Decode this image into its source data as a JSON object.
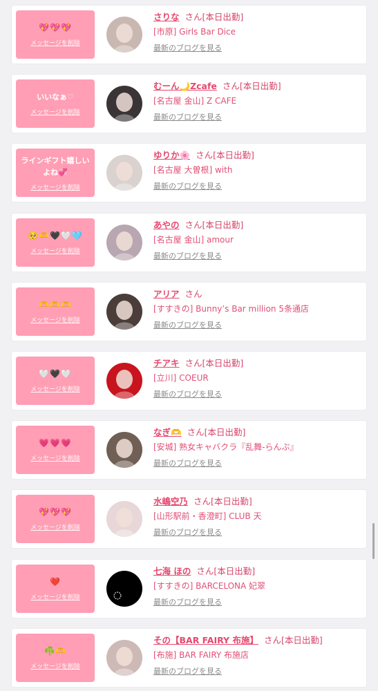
{
  "cards": [
    {
      "message": "💖💖💖",
      "message_is_emoji": true,
      "delete_label": "メッセージを削除",
      "name": "さりな",
      "san": "さん",
      "shift": "[本日出勤]",
      "shop": "[市原] Girls Bar Dice",
      "blog": "最新のブログを見る"
    },
    {
      "message": "いいなぁ♡",
      "message_is_emoji": false,
      "delete_label": "メッセージを削除",
      "name": "むーん🌙Zcafe",
      "san": "さん",
      "shift": "[本日出勤]",
      "shop": "[名古屋 金山] Z CAFE",
      "blog": "最新のブログを見る"
    },
    {
      "message": "ラインギフト嬉しいよね💞",
      "message_is_emoji": false,
      "delete_label": "メッセージを削除",
      "name": "ゆりか🌸",
      "san": "さん",
      "shift": "[本日出勤]",
      "shop": "[名古屋 大曽根] with",
      "blog": "最新のブログを見る"
    },
    {
      "message": "🥺🫶🖤🤍🩵",
      "message_is_emoji": true,
      "delete_label": "メッセージを削除",
      "name": "あやの",
      "san": "さん",
      "shift": "[本日出勤]",
      "shop": "[名古屋 金山] amour",
      "blog": "最新のブログを見る"
    },
    {
      "message": "🫶🫶🫶",
      "message_is_emoji": true,
      "delete_label": "メッセージを削除",
      "name": "アリア",
      "san": "さん",
      "shift": "",
      "shop": "[すすきの] Bunny’s Bar million 5条通店",
      "blog": "最新のブログを見る"
    },
    {
      "message": "🤍🖤🤍",
      "message_is_emoji": true,
      "delete_label": "メッセージを削除",
      "name": "チアキ",
      "san": "さん",
      "shift": "[本日出勤]",
      "shop": "[立川] COEUR",
      "blog": "最新のブログを見る"
    },
    {
      "message": "💗💗💗",
      "message_is_emoji": true,
      "delete_label": "メッセージを削除",
      "name": "なぎ🫶",
      "san": "さん",
      "shift": "[本日出勤]",
      "shop": "[安城] 熟女キャバクラ『乱舞-らんぶ』",
      "blog": "最新のブログを見る"
    },
    {
      "message": "💖💖💖",
      "message_is_emoji": true,
      "delete_label": "メッセージを削除",
      "name": "水嶋空乃",
      "san": "さん",
      "shift": "[本日出勤]",
      "shop": "[山形駅前・香澄町] CLUB 天",
      "blog": "最新のブログを見る"
    },
    {
      "message": "❤️",
      "message_is_emoji": true,
      "delete_label": "メッセージを削除",
      "name": "七海 ほの",
      "san": "さん",
      "shift": "[本日出勤]",
      "shop": "[すすきの] BARCELONA 妃翠",
      "blog": "最新のブログを見る"
    },
    {
      "message": "☘️🫶",
      "message_is_emoji": true,
      "delete_label": "メッセージを削除",
      "name": "その【BAR FAIRY 布施】",
      "san": "さん",
      "shift": "[本日出勤]",
      "shop": "[布施] BAR FAIRY 布施店",
      "blog": "最新のブログを見る"
    }
  ],
  "avatar_colors": [
    "#c9b7b2",
    "#3a3436",
    "#d9d2cf",
    "#b8a6b0",
    "#4a3d3a",
    "#c8141e",
    "#6f5f55",
    "#e7d7d8",
    "#000000",
    "#cdb9b5"
  ],
  "accent_color": "#ff9eb4"
}
